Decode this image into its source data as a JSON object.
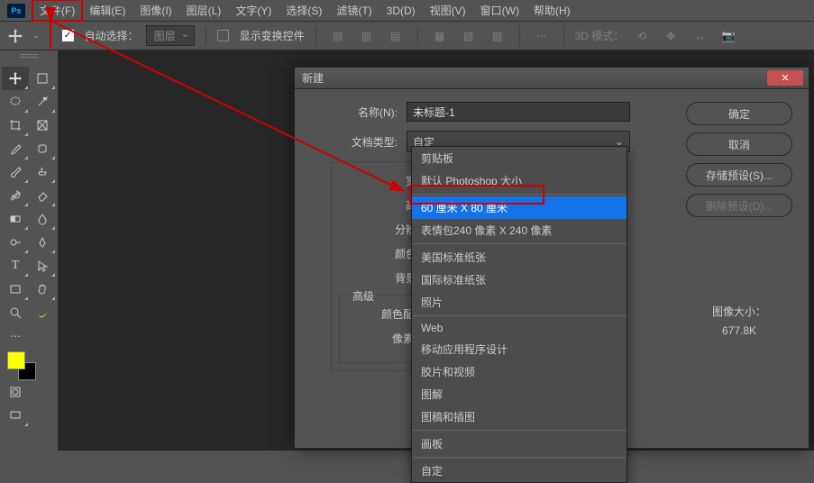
{
  "menubar": {
    "items": [
      "文件(F)",
      "编辑(E)",
      "图像(I)",
      "图层(L)",
      "文字(Y)",
      "选择(S)",
      "滤镜(T)",
      "3D(D)",
      "视图(V)",
      "窗口(W)",
      "帮助(H)"
    ]
  },
  "optbar": {
    "autoSelect": "自动选择：",
    "layerCombo": "图层",
    "showTransform": "显示变换控件",
    "mode3d": "3D 模式："
  },
  "dialog": {
    "title": "新建",
    "nameLabel": "名称(N):",
    "nameValue": "未标题-1",
    "docTypeLabel": "文档类型:",
    "docTypeValue": "自定",
    "widthPartial": "宽",
    "heightPartial": "高",
    "resPartial": "分辨",
    "colorPartial": "颜色",
    "bgPartial": "背景",
    "advanced": "高级",
    "profilePartial": "颜色配置",
    "aspectPartial": "像素长",
    "ok": "确定",
    "cancel": "取消",
    "savePreset": "存储预设(S)...",
    "deletePreset": "删除预设(D)...",
    "imgSizeLabel": "图像大小：",
    "imgSizeValue": "677.8K"
  },
  "dropdown": {
    "items": [
      {
        "label": "剪贴板",
        "sel": false
      },
      {
        "label": "默认 Photoshop 大小",
        "sel": false
      },
      {
        "sep": true
      },
      {
        "label": "60 厘米 X 80 厘米",
        "sel": true
      },
      {
        "label": "表情包240 像素 X 240 像素",
        "sel": false
      },
      {
        "sep": true
      },
      {
        "label": "美国标准纸张",
        "sel": false
      },
      {
        "label": "国际标准纸张",
        "sel": false
      },
      {
        "label": "照片",
        "sel": false
      },
      {
        "sep": true
      },
      {
        "label": "Web",
        "sel": false
      },
      {
        "label": "移动应用程序设计",
        "sel": false
      },
      {
        "label": "胶片和视频",
        "sel": false
      },
      {
        "label": "图解",
        "sel": false
      },
      {
        "label": "图稿和插图",
        "sel": false
      },
      {
        "sep": true
      },
      {
        "label": "画板",
        "sel": false
      },
      {
        "sep": true
      },
      {
        "label": "自定",
        "sel": false
      }
    ]
  }
}
